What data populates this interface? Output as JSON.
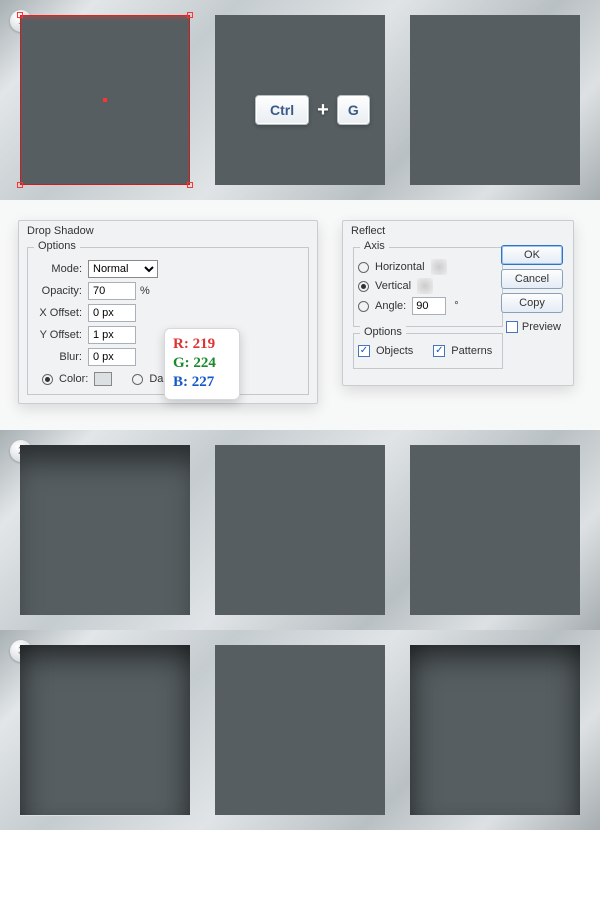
{
  "steps": {
    "s1": "1",
    "s2": "2",
    "s3": "3"
  },
  "keys": {
    "ctrl": "Ctrl",
    "g": "G"
  },
  "dropShadow": {
    "title": "Drop Shadow",
    "optionsLegend": "Options",
    "modeLabel": "Mode:",
    "modeValue": "Normal",
    "opacityLabel": "Opacity:",
    "opacityValue": "70",
    "opacityUnit": "%",
    "xoffLabel": "X Offset:",
    "xoffValue": "0 px",
    "yoffLabel": "Y Offset:",
    "yoffValue": "1 px",
    "blurLabel": "Blur:",
    "blurValue": "0 px",
    "colorLabel": "Color:",
    "darknessLabel": "Darkness:"
  },
  "rgb": {
    "rLabel": "R:",
    "rVal": "219",
    "gLabel": "G:",
    "gVal": "224",
    "bLabel": "B:",
    "bVal": "227"
  },
  "reflect": {
    "title": "Reflect",
    "axisLegend": "Axis",
    "horizontal": "Horizontal",
    "vertical": "Vertical",
    "angleLabel": "Angle:",
    "angleValue": "90",
    "degree": "°",
    "optionsLegend": "Options",
    "objects": "Objects",
    "patterns": "Patterns",
    "ok": "OK",
    "cancel": "Cancel",
    "copy": "Copy",
    "preview": "Preview"
  }
}
